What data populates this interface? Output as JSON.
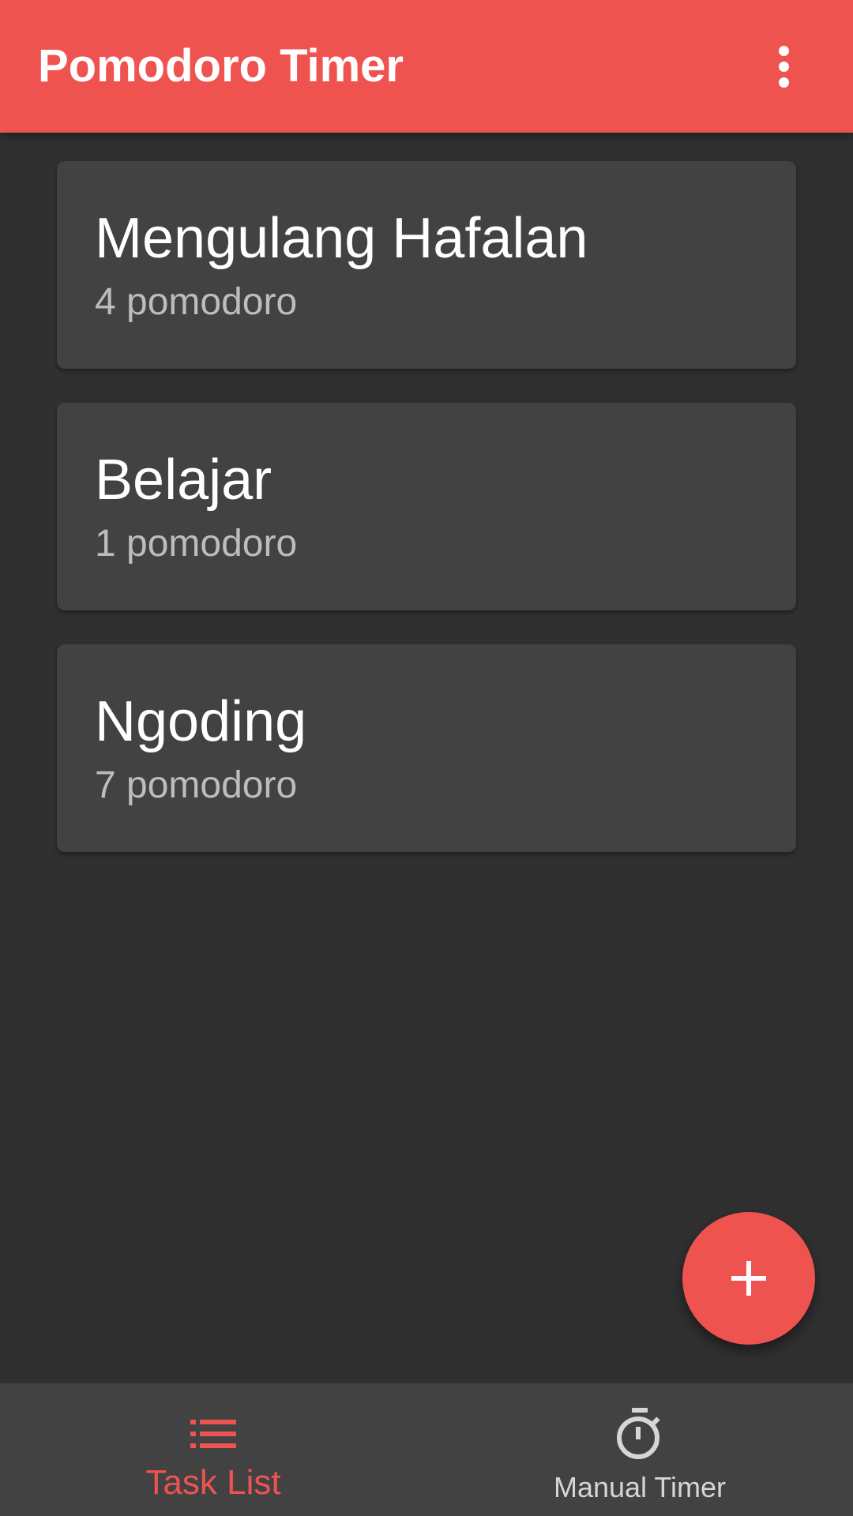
{
  "app": {
    "title": "Pomodoro Timer",
    "accent_color": "#EF5350",
    "background_color": "#303030",
    "card_color": "#424242"
  },
  "appbar": {
    "menu_icon": "more-vert-icon"
  },
  "tasks": [
    {
      "title": "Mengulang Hafalan",
      "count": "4 pomodoro"
    },
    {
      "title": "Belajar",
      "count": "1 pomodoro"
    },
    {
      "title": "Ngoding",
      "count": "7 pomodoro"
    }
  ],
  "fab": {
    "icon": "plus-icon"
  },
  "bottom_nav": {
    "items": [
      {
        "label": "Task List",
        "icon": "list-icon",
        "active": true
      },
      {
        "label": "Manual Timer",
        "icon": "timer-icon",
        "active": false
      }
    ]
  }
}
